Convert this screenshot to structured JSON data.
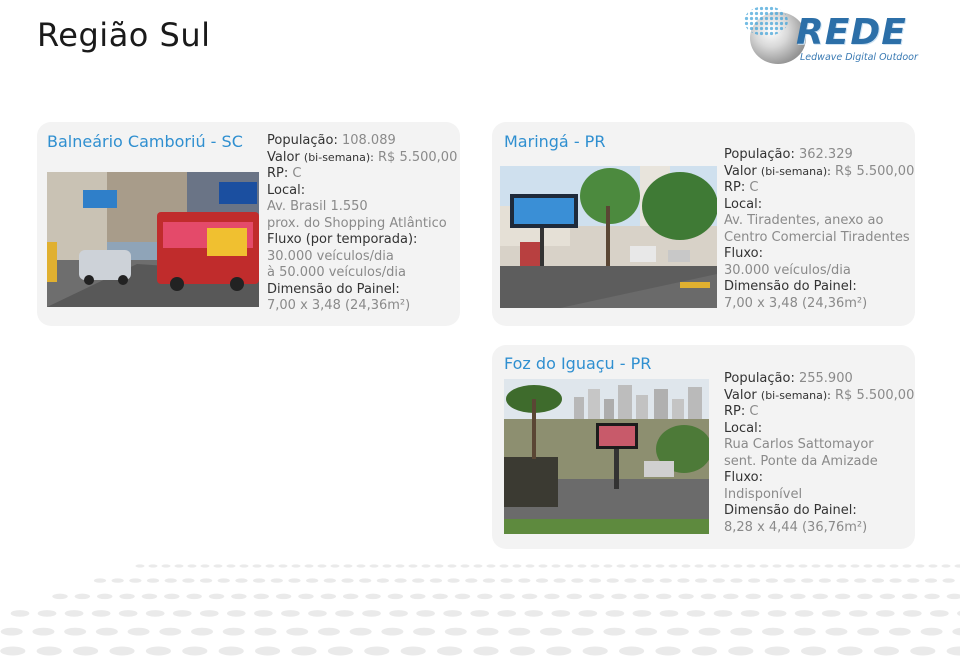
{
  "page": {
    "title": "Região Sul"
  },
  "logo": {
    "word": "REDE",
    "tagline": "Ledwave Digital Outdoor"
  },
  "cards": [
    {
      "name": "Balneário Camboriú - SC",
      "lines": [
        {
          "k": "População: ",
          "v": "108.089"
        },
        {
          "k": "Valor ",
          "ks": "(bi-semana):",
          "v": " R$ 5.500,00"
        },
        {
          "k": "RP: ",
          "v": "C"
        },
        {
          "k": "Local:",
          "v": ""
        },
        {
          "k": "",
          "v": "Av. Brasil 1.550"
        },
        {
          "k": "",
          "v": "prox. do Shopping Atlântico"
        },
        {
          "k": "Fluxo (por temporada):",
          "v": ""
        },
        {
          "k": "",
          "v": "30.000 veículos/dia"
        },
        {
          "k": "",
          "v": "à 50.000 veículos/dia"
        },
        {
          "k": "Dimensão do Painel:",
          "v": ""
        },
        {
          "k": "",
          "v": "7,00 x 3,48 (24,36m²)"
        }
      ]
    },
    {
      "name": "Maringá - PR",
      "lines": [
        {
          "k": "População: ",
          "v": "362.329"
        },
        {
          "k": "Valor ",
          "ks": "(bi-semana):",
          "v": " R$ 5.500,00"
        },
        {
          "k": "RP: ",
          "v": "C"
        },
        {
          "k": "Local:",
          "v": ""
        },
        {
          "k": "",
          "v": "Av. Tiradentes, anexo ao"
        },
        {
          "k": "",
          "v": "Centro Comercial Tiradentes"
        },
        {
          "k": "Fluxo:",
          "v": ""
        },
        {
          "k": "",
          "v": "30.000 veículos/dia"
        },
        {
          "k": "Dimensão do Painel:",
          "v": ""
        },
        {
          "k": "",
          "v": "7,00 x 3,48 (24,36m²)"
        }
      ]
    },
    {
      "name": "Foz do Iguaçu - PR",
      "lines": [
        {
          "k": "População: ",
          "v": "255.900"
        },
        {
          "k": "Valor ",
          "ks": "(bi-semana):",
          "v": " R$ 5.500,00"
        },
        {
          "k": "RP: ",
          "v": "C"
        },
        {
          "k": "Local:",
          "v": ""
        },
        {
          "k": "",
          "v": "Rua Carlos Sattomayor"
        },
        {
          "k": "",
          "v": "sent. Ponte da Amizade"
        },
        {
          "k": "Fluxo:",
          "v": ""
        },
        {
          "k": "",
          "v": "Indisponível"
        },
        {
          "k": "Dimensão do Painel:",
          "v": ""
        },
        {
          "k": "",
          "v": "8,28 x 4,44 (36,76m²)"
        }
      ]
    }
  ]
}
